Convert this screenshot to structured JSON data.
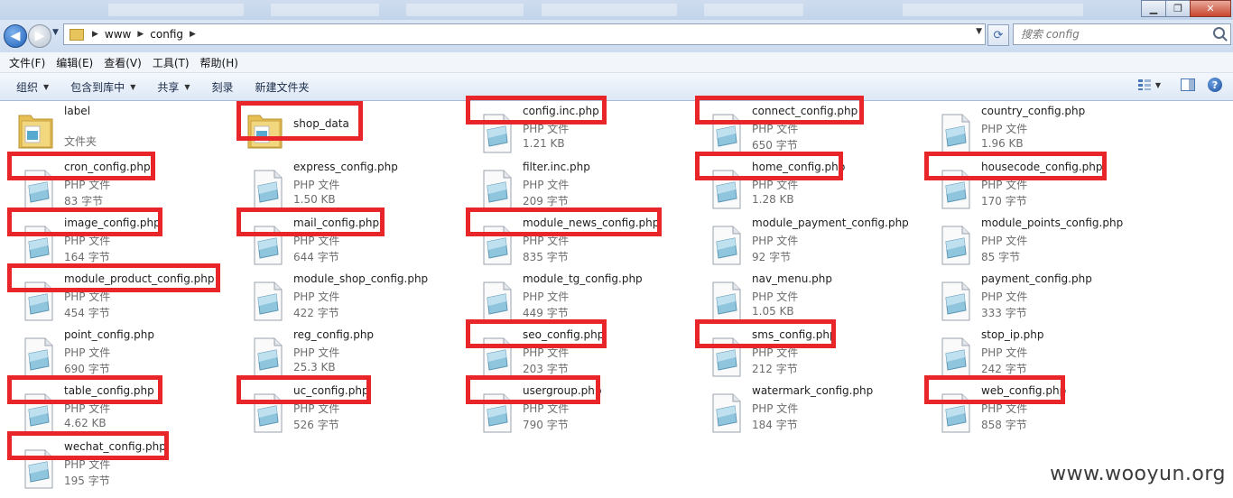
{
  "window": {
    "minimize_glyph": "▁",
    "maximize_glyph": "❐",
    "close_glyph": "✕"
  },
  "address": {
    "crumbs": [
      "www",
      "config"
    ],
    "search_placeholder": "搜索 config"
  },
  "menu": [
    "文件(F)",
    "编辑(E)",
    "查看(V)",
    "工具(T)",
    "帮助(H)"
  ],
  "toolbar": {
    "organize": "组织",
    "include_in_library": "包含到库中",
    "share": "共享",
    "burn": "刻录",
    "new_folder": "新建文件夹",
    "help": "?"
  },
  "files": [
    {
      "name": "label",
      "type": "文件夹",
      "size": "",
      "folder": true,
      "highlighted": false
    },
    {
      "name": "shop_data",
      "type": "",
      "size": "",
      "folder": true,
      "highlighted": true
    },
    {
      "name": "config.inc.php",
      "type": "PHP 文件",
      "size": "1.21 KB",
      "highlighted": true
    },
    {
      "name": "connect_config.php",
      "type": "PHP 文件",
      "size": "650 字节",
      "highlighted": true
    },
    {
      "name": "country_config.php",
      "type": "PHP 文件",
      "size": "1.96 KB",
      "highlighted": false
    },
    {
      "name": "cron_config.php",
      "type": "PHP 文件",
      "size": "83 字节",
      "highlighted": true
    },
    {
      "name": "express_config.php",
      "type": "PHP 文件",
      "size": "1.50 KB",
      "highlighted": false
    },
    {
      "name": "filter.inc.php",
      "type": "PHP 文件",
      "size": "209 字节",
      "highlighted": false
    },
    {
      "name": "home_config.php",
      "type": "PHP 文件",
      "size": "1.28 KB",
      "highlighted": true
    },
    {
      "name": "housecode_config.php",
      "type": "PHP 文件",
      "size": "170 字节",
      "highlighted": true
    },
    {
      "name": "image_config.php",
      "type": "PHP 文件",
      "size": "164 字节",
      "highlighted": true
    },
    {
      "name": "mail_config.php",
      "type": "PHP 文件",
      "size": "644 字节",
      "highlighted": true
    },
    {
      "name": "module_news_config.php",
      "type": "PHP 文件",
      "size": "835 字节",
      "highlighted": true
    },
    {
      "name": "module_payment_config.php",
      "type": "PHP 文件",
      "size": "92 字节",
      "highlighted": false
    },
    {
      "name": "module_points_config.php",
      "type": "PHP 文件",
      "size": "85 字节",
      "highlighted": false
    },
    {
      "name": "module_product_config.php",
      "type": "PHP 文件",
      "size": "454 字节",
      "highlighted": true
    },
    {
      "name": "module_shop_config.php",
      "type": "PHP 文件",
      "size": "422 字节",
      "highlighted": false
    },
    {
      "name": "module_tg_config.php",
      "type": "PHP 文件",
      "size": "449 字节",
      "highlighted": false
    },
    {
      "name": "nav_menu.php",
      "type": "PHP 文件",
      "size": "1.05 KB",
      "highlighted": false
    },
    {
      "name": "payment_config.php",
      "type": "PHP 文件",
      "size": "333 字节",
      "highlighted": false
    },
    {
      "name": "point_config.php",
      "type": "PHP 文件",
      "size": "690 字节",
      "highlighted": false
    },
    {
      "name": "reg_config.php",
      "type": "PHP 文件",
      "size": "25.3 KB",
      "highlighted": false
    },
    {
      "name": "seo_config.php",
      "type": "PHP 文件",
      "size": "203 字节",
      "highlighted": true
    },
    {
      "name": "sms_config.php",
      "type": "PHP 文件",
      "size": "212 字节",
      "highlighted": true
    },
    {
      "name": "stop_ip.php",
      "type": "PHP 文件",
      "size": "242 字节",
      "highlighted": false
    },
    {
      "name": "table_config.php",
      "type": "PHP 文件",
      "size": "4.62 KB",
      "highlighted": true
    },
    {
      "name": "uc_config.php",
      "type": "PHP 文件",
      "size": "526 字节",
      "highlighted": true
    },
    {
      "name": "usergroup.php",
      "type": "PHP 文件",
      "size": "790 字节",
      "highlighted": true
    },
    {
      "name": "watermark_config.php",
      "type": "PHP 文件",
      "size": "184 字节",
      "highlighted": false
    },
    {
      "name": "web_config.php",
      "type": "PHP 文件",
      "size": "858 字节",
      "highlighted": true
    },
    {
      "name": "wechat_config.php",
      "type": "PHP 文件",
      "size": "195 字节",
      "highlighted": true
    }
  ],
  "highlight_color": "#e8262a",
  "watermark": "www.wooyun.org"
}
